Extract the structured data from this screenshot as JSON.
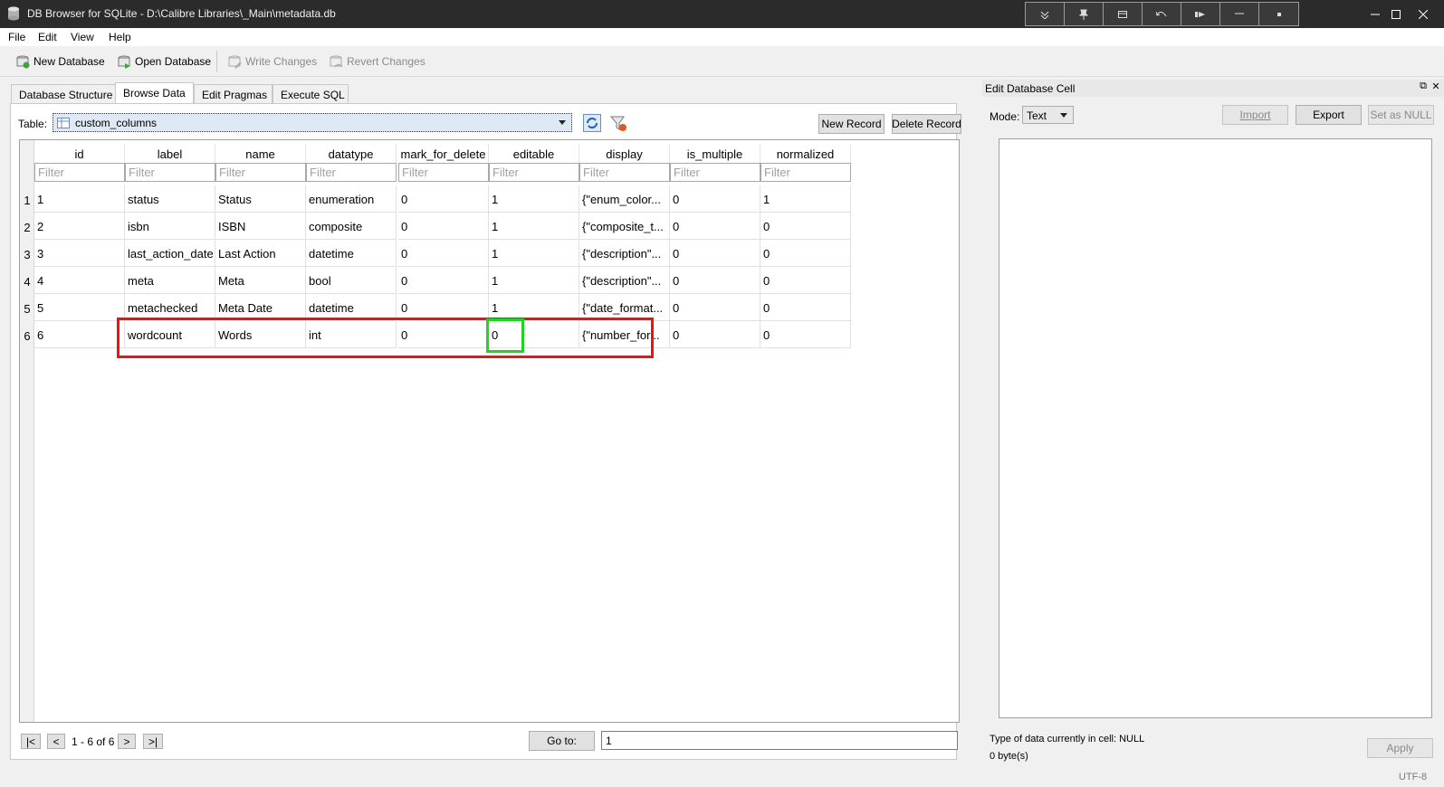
{
  "window": {
    "title": "DB Browser for SQLite - D:\\Calibre Libraries\\_Main\\metadata.db"
  },
  "menu": [
    "File",
    "Edit",
    "View",
    "Help"
  ],
  "toolbar": {
    "new_database": "New Database",
    "open_database": "Open Database",
    "write_changes": "Write Changes",
    "revert_changes": "Revert Changes"
  },
  "tabs": [
    "Database Structure",
    "Browse Data",
    "Edit Pragmas",
    "Execute SQL"
  ],
  "browse": {
    "table_label": "Table:",
    "table_value": "custom_columns",
    "new_record": "New Record",
    "delete_record": "Delete Record",
    "columns": [
      "id",
      "label",
      "name",
      "datatype",
      "mark_for_delete",
      "editable",
      "display",
      "is_multiple",
      "normalized"
    ],
    "filter_placeholder": "Filter",
    "rows": [
      {
        "num": "1",
        "cells": [
          "1",
          "status",
          "Status",
          "enumeration",
          "0",
          "1",
          "{\"enum_color...",
          "0",
          "1"
        ]
      },
      {
        "num": "2",
        "cells": [
          "2",
          "isbn",
          "ISBN",
          "composite",
          "0",
          "1",
          "{\"composite_t...",
          "0",
          "0"
        ]
      },
      {
        "num": "3",
        "cells": [
          "3",
          "last_action_date",
          "Last Action",
          "datetime",
          "0",
          "1",
          "{\"description\"...",
          "0",
          "0"
        ]
      },
      {
        "num": "4",
        "cells": [
          "4",
          "meta",
          "Meta",
          "bool",
          "0",
          "1",
          "{\"description\"...",
          "0",
          "0"
        ]
      },
      {
        "num": "5",
        "cells": [
          "5",
          "metachecked",
          "Meta Date",
          "datetime",
          "0",
          "1",
          "{\"date_format...",
          "0",
          "0"
        ]
      },
      {
        "num": "6",
        "cells": [
          "6",
          "wordcount",
          "Words",
          "int",
          "0",
          "0",
          "{\"number_for...",
          "0",
          "0"
        ]
      }
    ],
    "nav": {
      "first": "|<",
      "prev": "<",
      "range": "1 - 6 of 6",
      "next": ">",
      "last": ">|",
      "goto_label": "Go to:",
      "goto_value": "1"
    }
  },
  "edit_cell": {
    "title": "Edit Database Cell",
    "mode_label": "Mode:",
    "mode_value": "Text",
    "import": "Import",
    "export": "Export",
    "set_null": "Set as NULL",
    "type_text": "Type of data currently in cell: NULL",
    "size_text": "0 byte(s)",
    "apply": "Apply"
  },
  "status_bar": {
    "encoding": "UTF-8"
  },
  "colors": {
    "titlebar": "#2b2b2b",
    "highlight_red": "#e81515",
    "highlight_green": "#22d322"
  }
}
